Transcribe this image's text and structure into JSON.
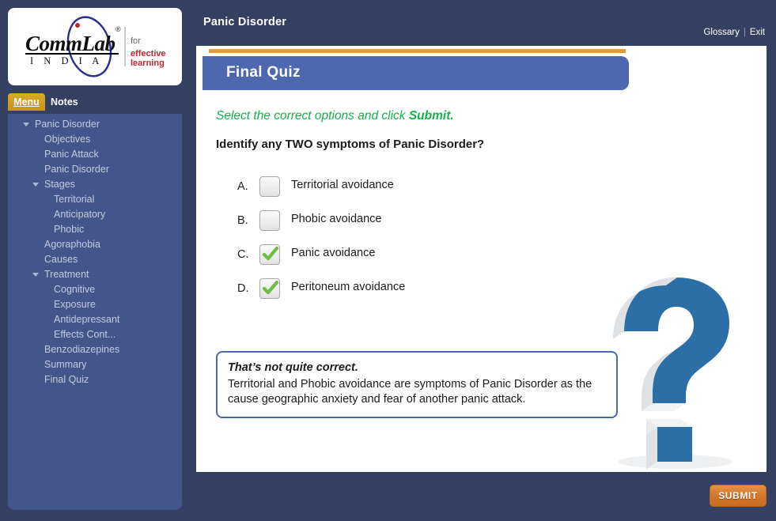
{
  "colors": {
    "frame_navy": "#344062",
    "sidebar_panel": "#44558c",
    "banner_blue": "#4d68ae",
    "accent_orange": "#e8963c",
    "tab_gold": "#cfa01c",
    "instruction_green": "#14b04a",
    "feedback_border": "#4a68b0",
    "qmark_blue": "#2c6fa6",
    "check_green": "#6fbe44"
  },
  "sidebar": {
    "logo": {
      "brand": "CommLab",
      "country": "I N D I A",
      "registered_mark": "®",
      "tagline_line1": "for",
      "tagline_line2_italic": "e",
      "tagline_line2": "ffective learning"
    },
    "tabs": [
      {
        "label": "Menu",
        "active": true
      },
      {
        "label": "Notes",
        "active": false
      }
    ],
    "nav_items": [
      {
        "label": "Panic Disorder",
        "level": 0,
        "twisty": true
      },
      {
        "label": "Objectives",
        "level": 1,
        "twisty": false
      },
      {
        "label": "Panic Attack",
        "level": 1,
        "twisty": false
      },
      {
        "label": "Panic Disorder",
        "level": 1,
        "twisty": false
      },
      {
        "label": "Stages",
        "level": 1,
        "twisty": true
      },
      {
        "label": "Territorial",
        "level": 2,
        "twisty": false
      },
      {
        "label": "Anticipatory",
        "level": 2,
        "twisty": false
      },
      {
        "label": "Phobic",
        "level": 2,
        "twisty": false
      },
      {
        "label": "Agoraphobia",
        "level": 1,
        "twisty": false
      },
      {
        "label": "Causes",
        "level": 1,
        "twisty": false
      },
      {
        "label": "Treatment",
        "level": 1,
        "twisty": true
      },
      {
        "label": "Cognitive",
        "level": 2,
        "twisty": false
      },
      {
        "label": "Exposure",
        "level": 2,
        "twisty": false
      },
      {
        "label": "Antidepressant",
        "level": 2,
        "twisty": false
      },
      {
        "label": "Effects Cont...",
        "level": 2,
        "twisty": false
      },
      {
        "label": "Benzodiazepines",
        "level": 1,
        "twisty": false
      },
      {
        "label": "Summary",
        "level": 1,
        "twisty": false
      },
      {
        "label": "Final Quiz",
        "level": 1,
        "twisty": false
      }
    ]
  },
  "header": {
    "course_title": "Panic Disorder",
    "glossary_label": "Glossary",
    "separator": "|",
    "exit_label": "Exit"
  },
  "banner": {
    "title": "Final Quiz"
  },
  "quiz": {
    "instruction_prefix": "Select the correct options and click ",
    "instruction_bold": "Submit.",
    "question": "Identify any TWO symptoms of Panic Disorder?",
    "options": [
      {
        "letter": "A.",
        "label": "Territorial avoidance",
        "checked": false
      },
      {
        "letter": "B.",
        "label": "Phobic avoidance",
        "checked": false
      },
      {
        "letter": "C.",
        "label": "Panic avoidance",
        "checked": true
      },
      {
        "letter": "D.",
        "label": "Peritoneum avoidance",
        "checked": true
      }
    ],
    "feedback": {
      "heading": "That’s not quite correct.",
      "body": "Territorial and Phobic avoidance are symptoms of Panic Disorder as the cause geographic anxiety and fear of another panic attack."
    }
  },
  "footer": {
    "submit_label": "SUBMIT"
  }
}
